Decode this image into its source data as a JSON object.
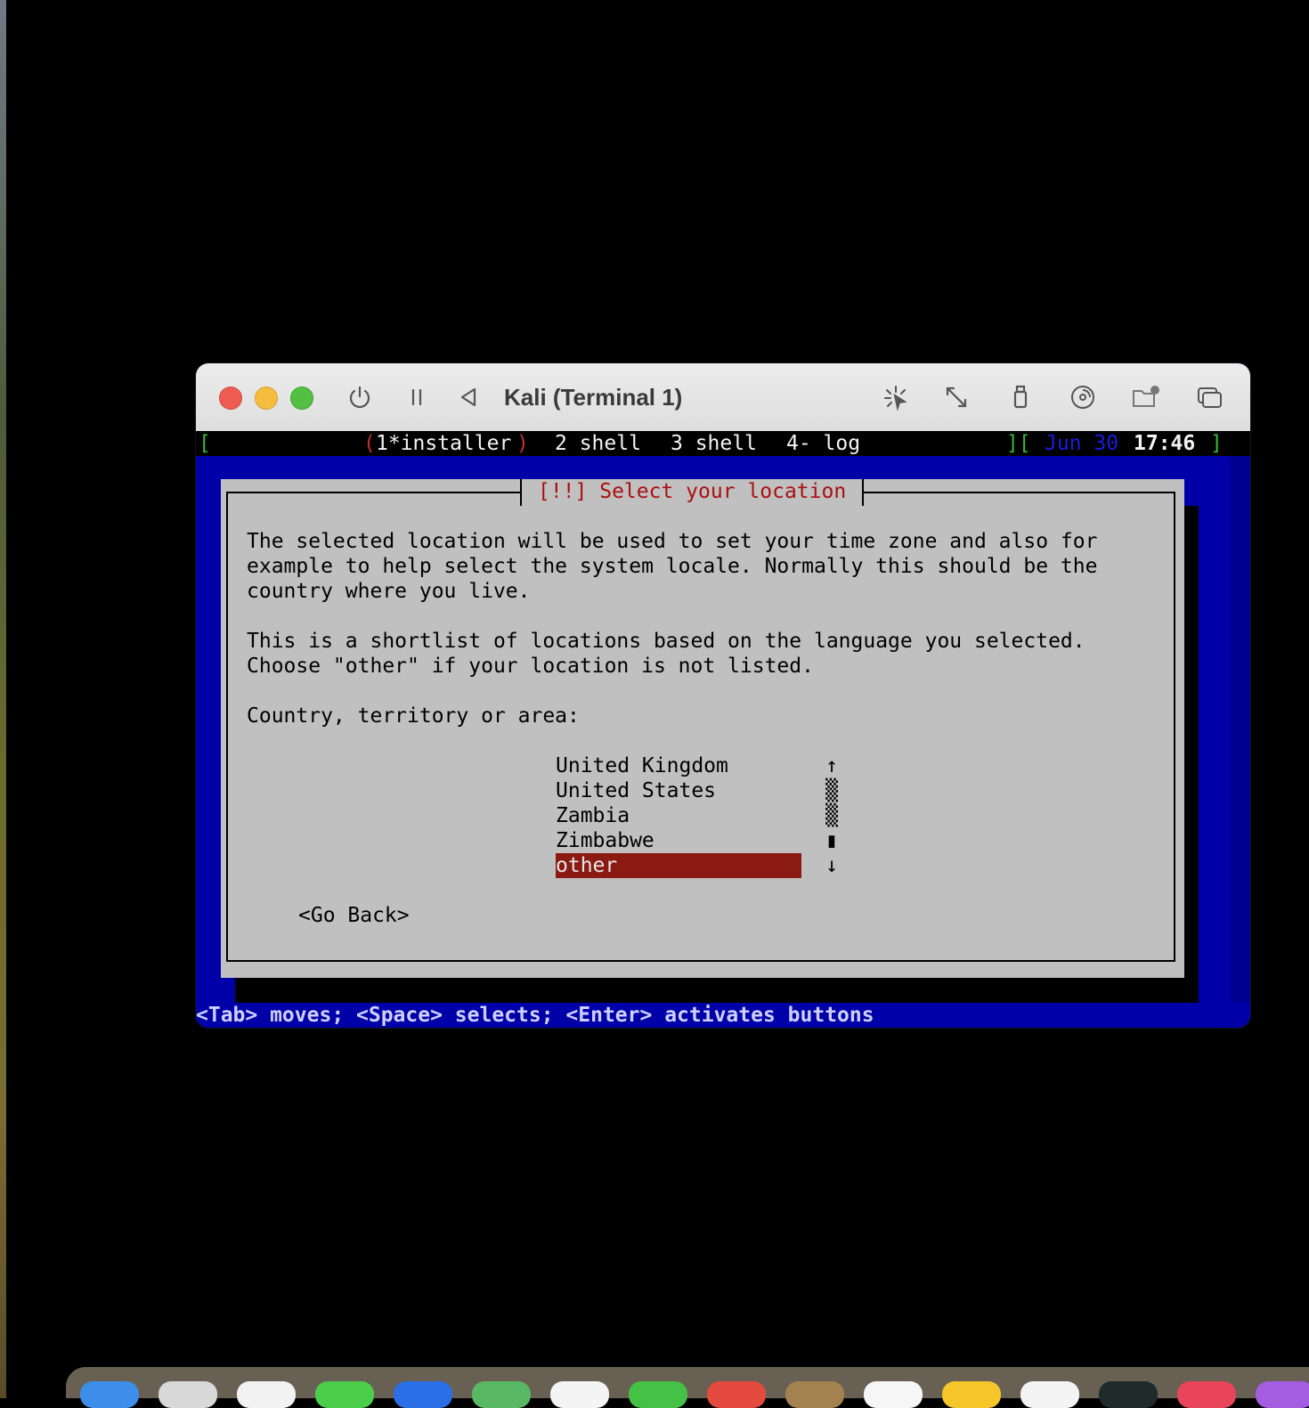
{
  "window": {
    "title": "Kali (Terminal 1)"
  },
  "statusbar": {
    "open_bracket": "[",
    "paren_open": "(",
    "active_tab": "1*installer",
    "paren_close": ")",
    "tabs": [
      "2 shell",
      "3 shell",
      "4- log"
    ],
    "close_open": "][",
    "date": "Jun 30",
    "time": "17:46",
    "close_bracket": "]"
  },
  "dialog": {
    "title": "[!!] Select your location",
    "text": "The selected location will be used to set your time zone and also for\nexample to help select the system locale. Normally this should be the\ncountry where you live.\n\nThis is a shortlist of locations based on the language you selected.\nChoose \"other\" if your location is not listed.\n\nCountry, territory or area:",
    "options": [
      "United Kingdom",
      "United States",
      "Zambia",
      "Zimbabwe",
      "other"
    ],
    "selected_index": 4,
    "scrollbar": [
      "↑",
      "▒",
      "▒",
      "▮",
      "↓"
    ],
    "back_button": "<Go Back>"
  },
  "hint": "<Tab> moves; <Space> selects; <Enter> activates buttons",
  "colors": {
    "terminal_bg": "#0000a8",
    "dialog_bg": "#c0c0c0",
    "title_red": "#aa1010",
    "selected_bg": "#8b1a12"
  }
}
